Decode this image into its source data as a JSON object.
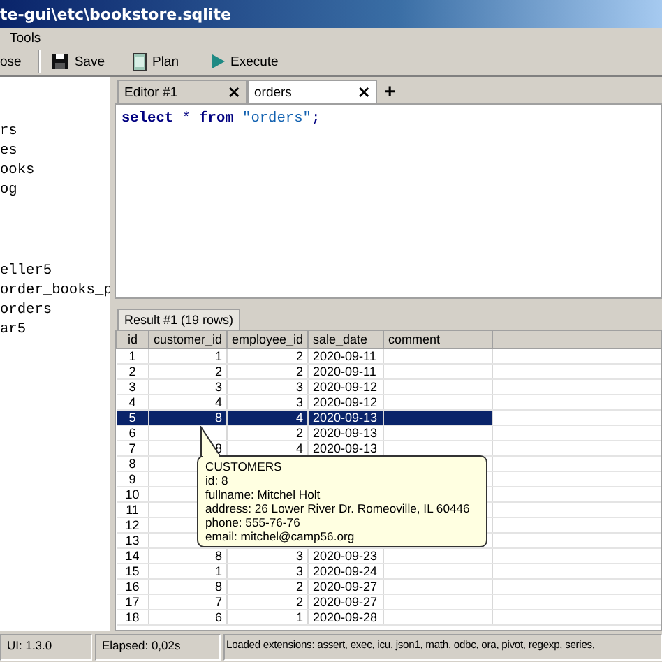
{
  "window": {
    "title": "te-gui\\etc\\bookstore.sqlite"
  },
  "menu": [
    "Tools"
  ],
  "toolbar": [
    {
      "kind": "text",
      "label": "ose"
    },
    {
      "kind": "save",
      "label": "Save"
    },
    {
      "kind": "plan",
      "label": "Plan"
    },
    {
      "kind": "execute",
      "label": "Execute"
    }
  ],
  "tree": {
    "items": [
      "rs",
      "es",
      "ooks",
      "og",
      "eller5",
      "order_books_p",
      "orders",
      "ar5"
    ]
  },
  "editor_tabs": [
    {
      "label": "Editor #1",
      "close": "✕",
      "selected": false
    },
    {
      "label": "orders",
      "close": "✕",
      "selected": true
    }
  ],
  "add_tab": "+",
  "editor": {
    "tokens": [
      {
        "kind": "keyword",
        "text": "select"
      },
      {
        "kind": "plain",
        "text": " * "
      },
      {
        "kind": "keyword",
        "text": "from"
      },
      {
        "kind": "string",
        "text": " \"orders\""
      },
      {
        "kind": "plain",
        "text": ";"
      }
    ]
  },
  "result_tab": {
    "label": "Result #1 (19 rows)",
    "selected": true
  },
  "table": {
    "columns": [
      "id",
      "customer_id",
      "employee_id",
      "sale_date",
      "comment"
    ],
    "rows": [
      {
        "cells": [
          "1",
          "1",
          "2",
          "2020-09-11"
        ],
        "selected": false
      },
      {
        "cells": [
          "2",
          "2",
          "2",
          "2020-09-11"
        ],
        "selected": false
      },
      {
        "cells": [
          "3",
          "3",
          "3",
          "2020-09-12"
        ],
        "selected": false
      },
      {
        "cells": [
          "4",
          "4",
          "3",
          "2020-09-12"
        ],
        "selected": false
      },
      {
        "cells": [
          "5",
          "8",
          "4",
          "2020-09-13"
        ],
        "selected": true
      },
      {
        "cells": [
          "6",
          null,
          "2",
          "2020-09-13"
        ],
        "selected": false
      },
      {
        "cells": [
          "7",
          "8",
          "4",
          "2020-09-13"
        ],
        "selected": false
      },
      {
        "cells": [
          "8"
        ],
        "selected": false
      },
      {
        "cells": [
          "9"
        ],
        "selected": false
      },
      {
        "cells": [
          "10"
        ],
        "selected": false
      },
      {
        "cells": [
          "11"
        ],
        "selected": false
      },
      {
        "cells": [
          "12"
        ],
        "selected": false
      },
      {
        "cells": [
          "13"
        ],
        "selected": false
      },
      {
        "cells": [
          "14",
          "8",
          "3",
          "2020-09-23"
        ],
        "selected": false
      },
      {
        "cells": [
          "15",
          "1",
          "3",
          "2020-09-24"
        ],
        "selected": false
      },
      {
        "cells": [
          "16",
          "8",
          "2",
          "2020-09-27"
        ],
        "selected": false
      },
      {
        "cells": [
          "17",
          "7",
          "2",
          "2020-09-27"
        ],
        "selected": false
      },
      {
        "cells": [
          "18",
          "6",
          "1",
          "2020-09-28"
        ],
        "selected": false
      }
    ]
  },
  "tooltip": {
    "lines": [
      "CUSTOMERS",
      "id: 8",
      "fullname: Mitchel Holt",
      "address: 26 Lower River Dr. Romeoville, IL 60446",
      "phone: 555-76-76",
      "email: mitchel@camp56.org"
    ]
  },
  "status_bar": [
    "UI: 1.3.0",
    "Elapsed: 0,02s",
    "Loaded extensions: assert, exec, icu, json1, math, odbc, ora, pivot, regexp, series,"
  ]
}
